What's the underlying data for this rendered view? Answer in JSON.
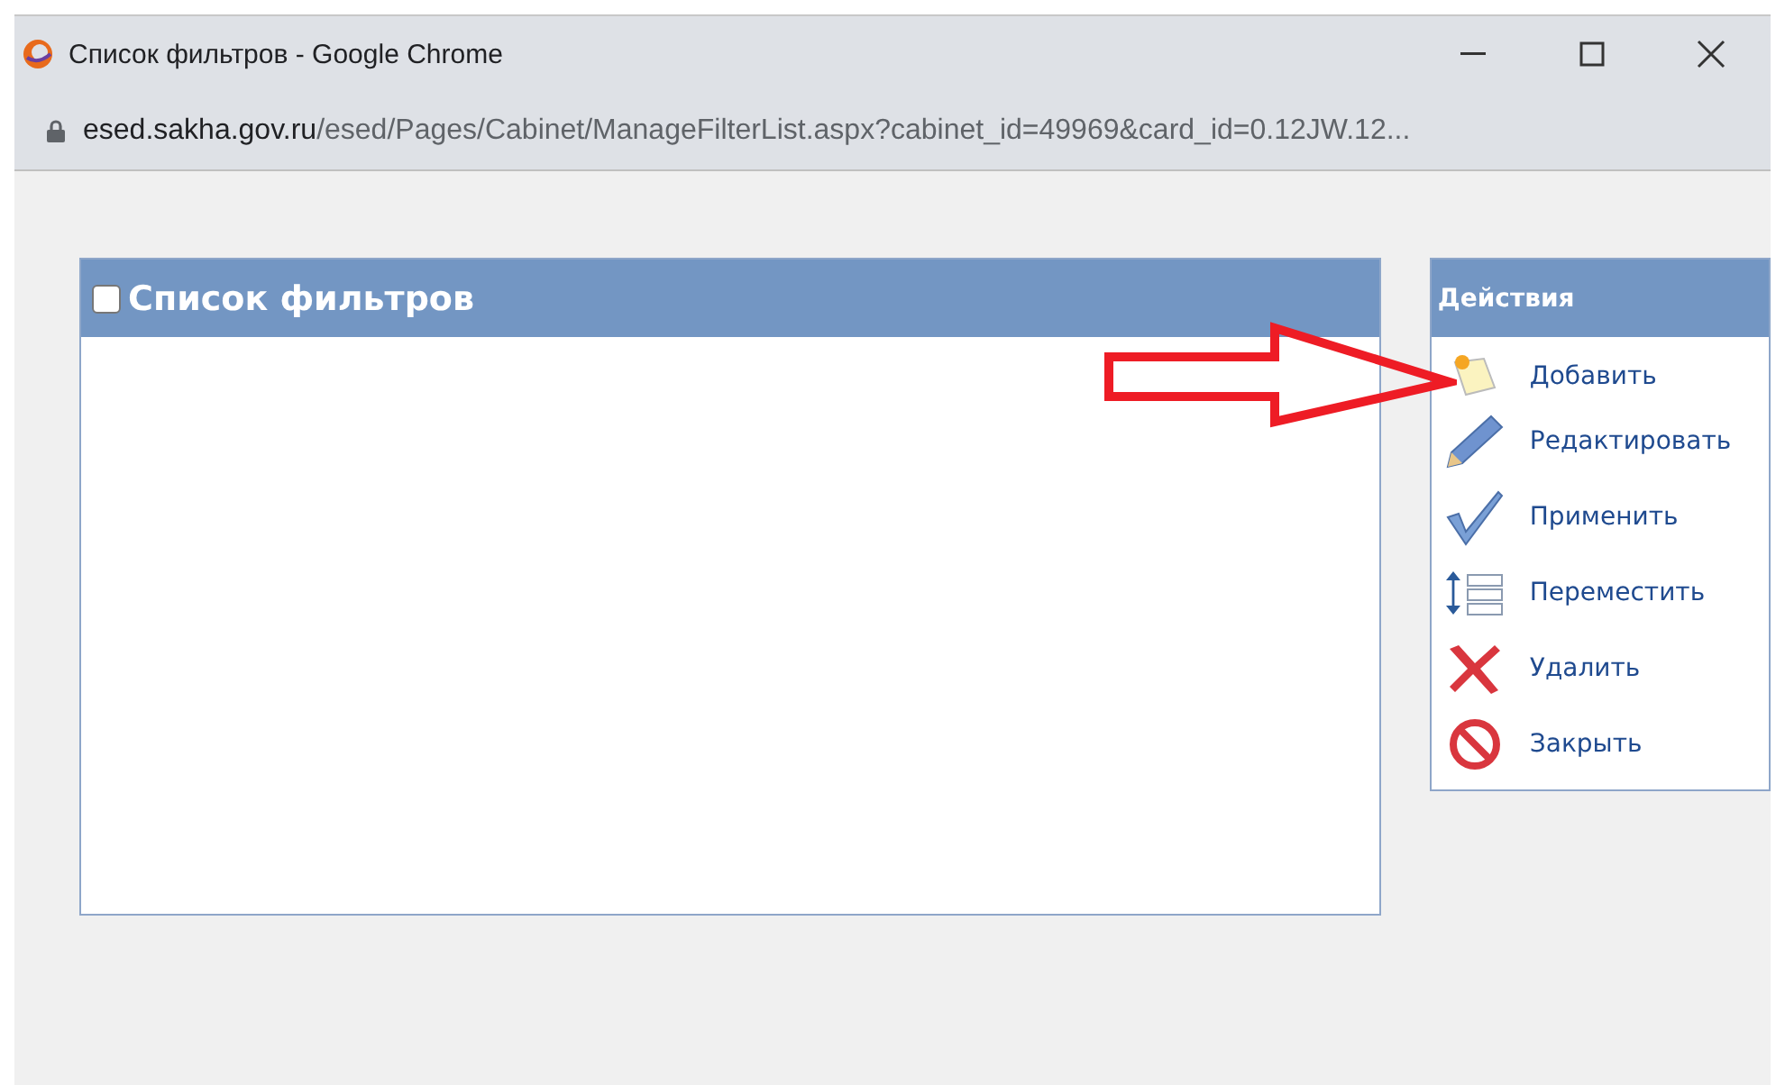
{
  "window": {
    "title": "Список фильтров - Google Chrome"
  },
  "address": {
    "host": "esed.sakha.gov.ru",
    "path": "/esed/Pages/Cabinet/ManageFilterList.aspx?cabinet_id=49969&card_id=0.12JW.12..."
  },
  "filter_panel": {
    "title": "Список фильтров",
    "checked": false
  },
  "actions": {
    "title": "Действия",
    "items": [
      {
        "kind": "add",
        "label": "Добавить"
      },
      {
        "kind": "edit",
        "label": "Редактировать"
      },
      {
        "kind": "apply",
        "label": "Применить"
      },
      {
        "kind": "move",
        "label": "Переместить"
      },
      {
        "kind": "delete",
        "label": "Удалить"
      },
      {
        "kind": "close",
        "label": "Закрыть"
      }
    ]
  }
}
